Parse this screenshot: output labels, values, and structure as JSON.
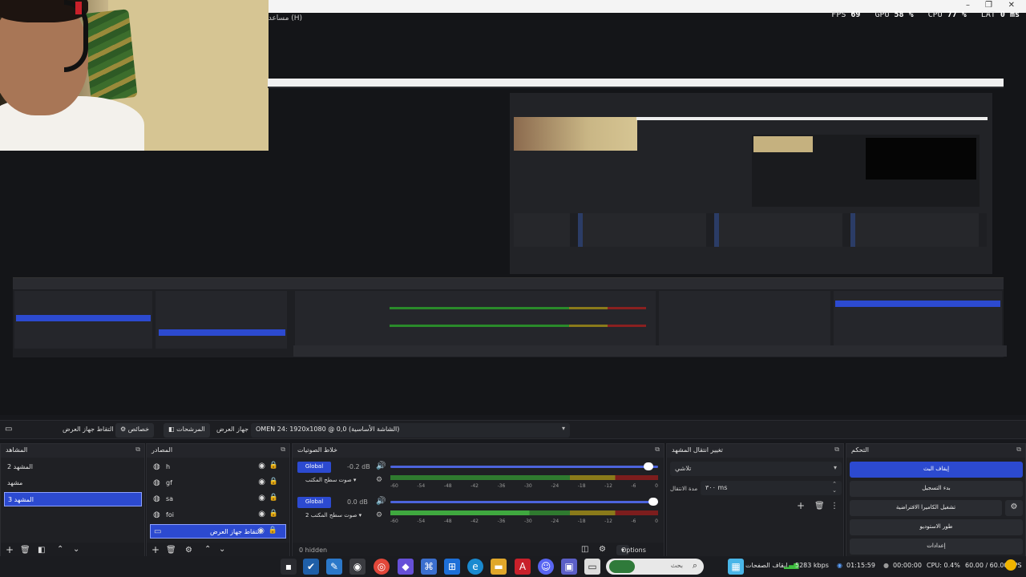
{
  "top_stats": {
    "fps_label": "FPS",
    "fps": "69",
    "gpu_label": "GPU",
    "gpu": "58 %",
    "cpu_label": "CPU",
    "cpu": "77 %",
    "lat_label": "LAT",
    "lat": "0 ms"
  },
  "window": {
    "help_menu": "مساعدة (H)"
  },
  "source_toolbar": {
    "source_name": "التقاط جهاز العرض",
    "properties_label": "خصائص",
    "filters_label": "المرشحات",
    "display_label": "جهاز العرض",
    "display_value": "OMEN 24: 1920x1080 @ 0,0 (الشاشة الأساسية)"
  },
  "scenes": {
    "title": "المشاهد",
    "items": [
      "المشهد 2",
      "مشهد",
      "المشهد 3"
    ],
    "selected_index": 2
  },
  "sources": {
    "title": "المصادر",
    "items": [
      "h",
      "gf",
      "sa",
      "foi",
      "التقاط جهاز العرض"
    ],
    "selected_index": 4
  },
  "mixer": {
    "title": "خلاط الصوتيات",
    "global_label": "Global",
    "channels": [
      {
        "db": "-0.2 dB",
        "label": "صوت سطح المكتب",
        "level": 0.98
      },
      {
        "db": "0.0 dB",
        "label": "صوت سطح المكتب 2",
        "level": 1.0
      }
    ],
    "ticks": [
      "-60",
      "-54",
      "-48",
      "-42",
      "-36",
      "-30",
      "-24",
      "-18",
      "-12",
      "-6",
      "0"
    ],
    "hidden_label": "0 hidden",
    "options_label": "Options"
  },
  "transitions": {
    "title": "تغيير انتقال المشهد",
    "type_value": "تلاشي",
    "duration_label": "مدة الانتقال",
    "duration_value": "٣٠٠ ms"
  },
  "controls": {
    "title": "التحكم",
    "buttons": [
      "إيقاف البث",
      "بدء التسجيل",
      "تشغيل الكاميرا الافتراضية",
      "طور الاستوديو",
      "إعدادات"
    ]
  },
  "taskbar": {
    "search_placeholder": "بحث",
    "status_text": "إيقاف الصفحات",
    "bitrate": "5283 kbps",
    "stream_time": "01:15:59",
    "rec_time": "00:00:00",
    "cpu": "CPU: 0.4%",
    "fps": "60.00 / 60.00 FPS"
  },
  "colors": {
    "accent": "#2c4ad0",
    "panel": "#1f2024",
    "background": "#17181c"
  }
}
